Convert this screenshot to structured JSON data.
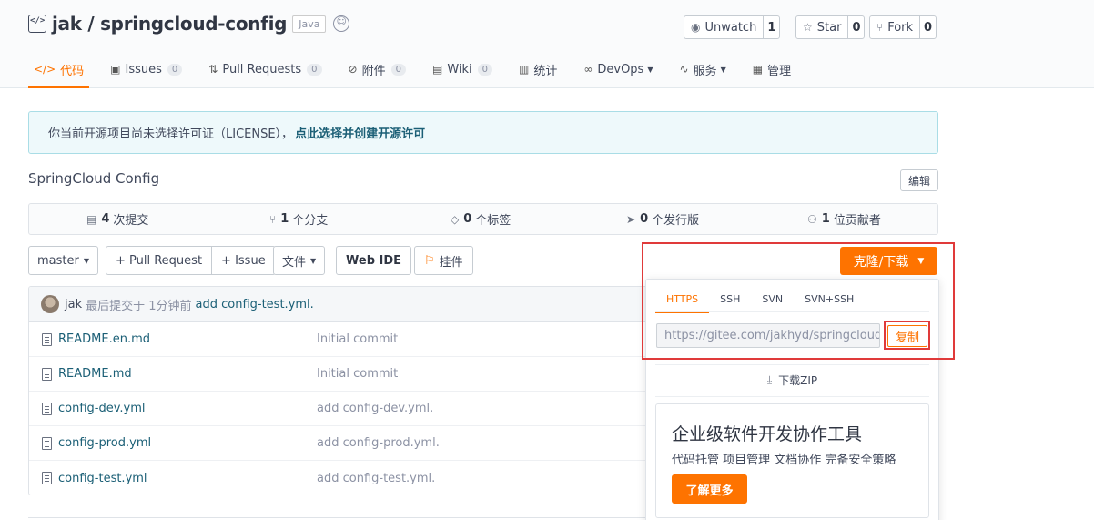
{
  "repo": {
    "title": "jak / springcloud-config",
    "language": "Java",
    "description": "SpringCloud Config"
  },
  "actions": [
    {
      "label": "Unwatch",
      "icon": "eye-icon",
      "count": "1"
    },
    {
      "label": "Star",
      "icon": "star-icon",
      "count": "0"
    },
    {
      "label": "Fork",
      "icon": "fork-icon",
      "count": "0"
    }
  ],
  "tabs": [
    {
      "label": "代码",
      "icon": "code-icon",
      "count": "",
      "active": true
    },
    {
      "label": "Issues",
      "icon": "issues-icon",
      "count": "0"
    },
    {
      "label": "Pull Requests",
      "icon": "pull-request-icon",
      "count": "0"
    },
    {
      "label": "附件",
      "icon": "attachment-icon",
      "count": "0"
    },
    {
      "label": "Wiki",
      "icon": "wiki-icon",
      "count": "0"
    },
    {
      "label": "统计",
      "icon": "stats-icon",
      "count": ""
    },
    {
      "label": "DevOps",
      "icon": "devops-icon",
      "count": ""
    },
    {
      "label": "服务",
      "icon": "service-icon",
      "count": ""
    },
    {
      "label": "管理",
      "icon": "manage-icon",
      "count": ""
    }
  ],
  "notice": {
    "text": "你当前开源项目尚未选择许可证（LICENSE），",
    "link": "点此选择并创建开源许可"
  },
  "edit_label": "编辑",
  "stats": [
    {
      "count": "4",
      "label": "次提交"
    },
    {
      "count": "1",
      "label": "个分支"
    },
    {
      "count": "0",
      "label": "个标签"
    },
    {
      "count": "0",
      "label": "个发行版"
    },
    {
      "count": "1",
      "label": "位贡献者"
    }
  ],
  "toolbar": {
    "branch": "master",
    "pull_request": "+ Pull Request",
    "issue": "+ Issue",
    "file": "文件",
    "web_ide": "Web IDE",
    "widget": "挂件",
    "clone": "克隆/下载"
  },
  "last_commit": {
    "author": "jak",
    "text": "最后提交于 1分钟前",
    "message": "add config-test.yml."
  },
  "files": [
    {
      "name": "README.en.md",
      "message": "Initial commit"
    },
    {
      "name": "README.md",
      "message": "Initial commit"
    },
    {
      "name": "config-dev.yml",
      "message": "add config-dev.yml."
    },
    {
      "name": "config-prod.yml",
      "message": "add config-prod.yml."
    },
    {
      "name": "config-test.yml",
      "message": "add config-test.yml."
    }
  ],
  "clone_panel": {
    "protocols": [
      "HTTPS",
      "SSH",
      "SVN",
      "SVN+SSH"
    ],
    "url": "https://gitee.com/jakhyd/springcloud-config.git",
    "copy": "复制",
    "zip": "下载ZIP",
    "promo_title": "企业级软件开发协作工具",
    "promo_subtitle": "代码托管 项目管理 文档协作 完备安全策略",
    "promo_button": "了解更多"
  },
  "colors": {
    "accent": "#fe7300",
    "highlight": "#e03a3a",
    "link": "#1b5f76"
  }
}
